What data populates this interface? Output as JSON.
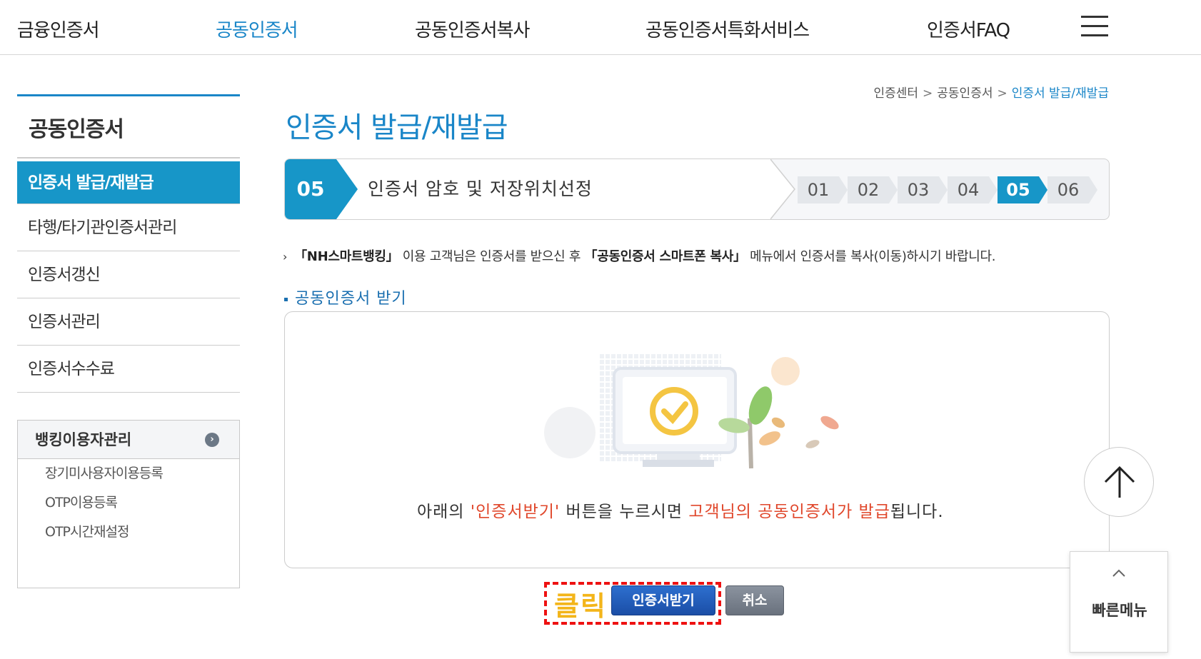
{
  "topnav": {
    "items": [
      "금융인증서",
      "공동인증서",
      "공동인증서복사",
      "공동인증서특화서비스",
      "인증서FAQ"
    ],
    "active_index": 1
  },
  "sidebar": {
    "title": "공동인증서",
    "items": [
      "인증서 발급/재발급",
      "타행/타기관인증서관리",
      "인증서갱신",
      "인증서관리",
      "인증서수수료"
    ],
    "active_index": 0,
    "box": {
      "title": "뱅킹이용자관리",
      "items": [
        "장기미사용자이용등록",
        "OTP이용등록",
        "OTP시간재설정"
      ]
    }
  },
  "breadcrumb": [
    "인증센터",
    "공동인증서",
    "인증서 발급/재발급"
  ],
  "page_title": "인증서 발급/재발급",
  "step": {
    "current_number": "05",
    "current_label": "인증서 암호 및 저장위치선정",
    "chips": [
      "01",
      "02",
      "03",
      "04",
      "05",
      "06"
    ],
    "active_chip": 4
  },
  "notice": {
    "mark": "›",
    "part1": "「NH스마트뱅킹」",
    "part2": " 이용 고객님은 인증서를 받으신 후 ",
    "part3": "「공동인증서 스마트폰 복사」",
    "part4": " 메뉴에서 인증서를 복사(이동)하시기 바랍니다."
  },
  "section_title": "공동인증서 받기",
  "panel_message": {
    "part1": "아래의 ",
    "part2": "'인증서받기'",
    "part3": " 버튼을 누르시면 ",
    "part4": "고객님의 공동인증서가 발급",
    "part5": "됩니다."
  },
  "buttons": {
    "click_label": "클릭",
    "issue": "인증서받기",
    "cancel": "취소"
  },
  "quick_menu": {
    "label": "빠른메뉴"
  },
  "colors": {
    "accent": "#1796c8",
    "highlight": "#e0472b",
    "click_label": "#f3b51a",
    "click_box": "#ee1111"
  },
  "icons": [
    "hamburger-menu-icon",
    "chevron-right-icon",
    "arrow-up-icon",
    "chevron-up-icon"
  ]
}
